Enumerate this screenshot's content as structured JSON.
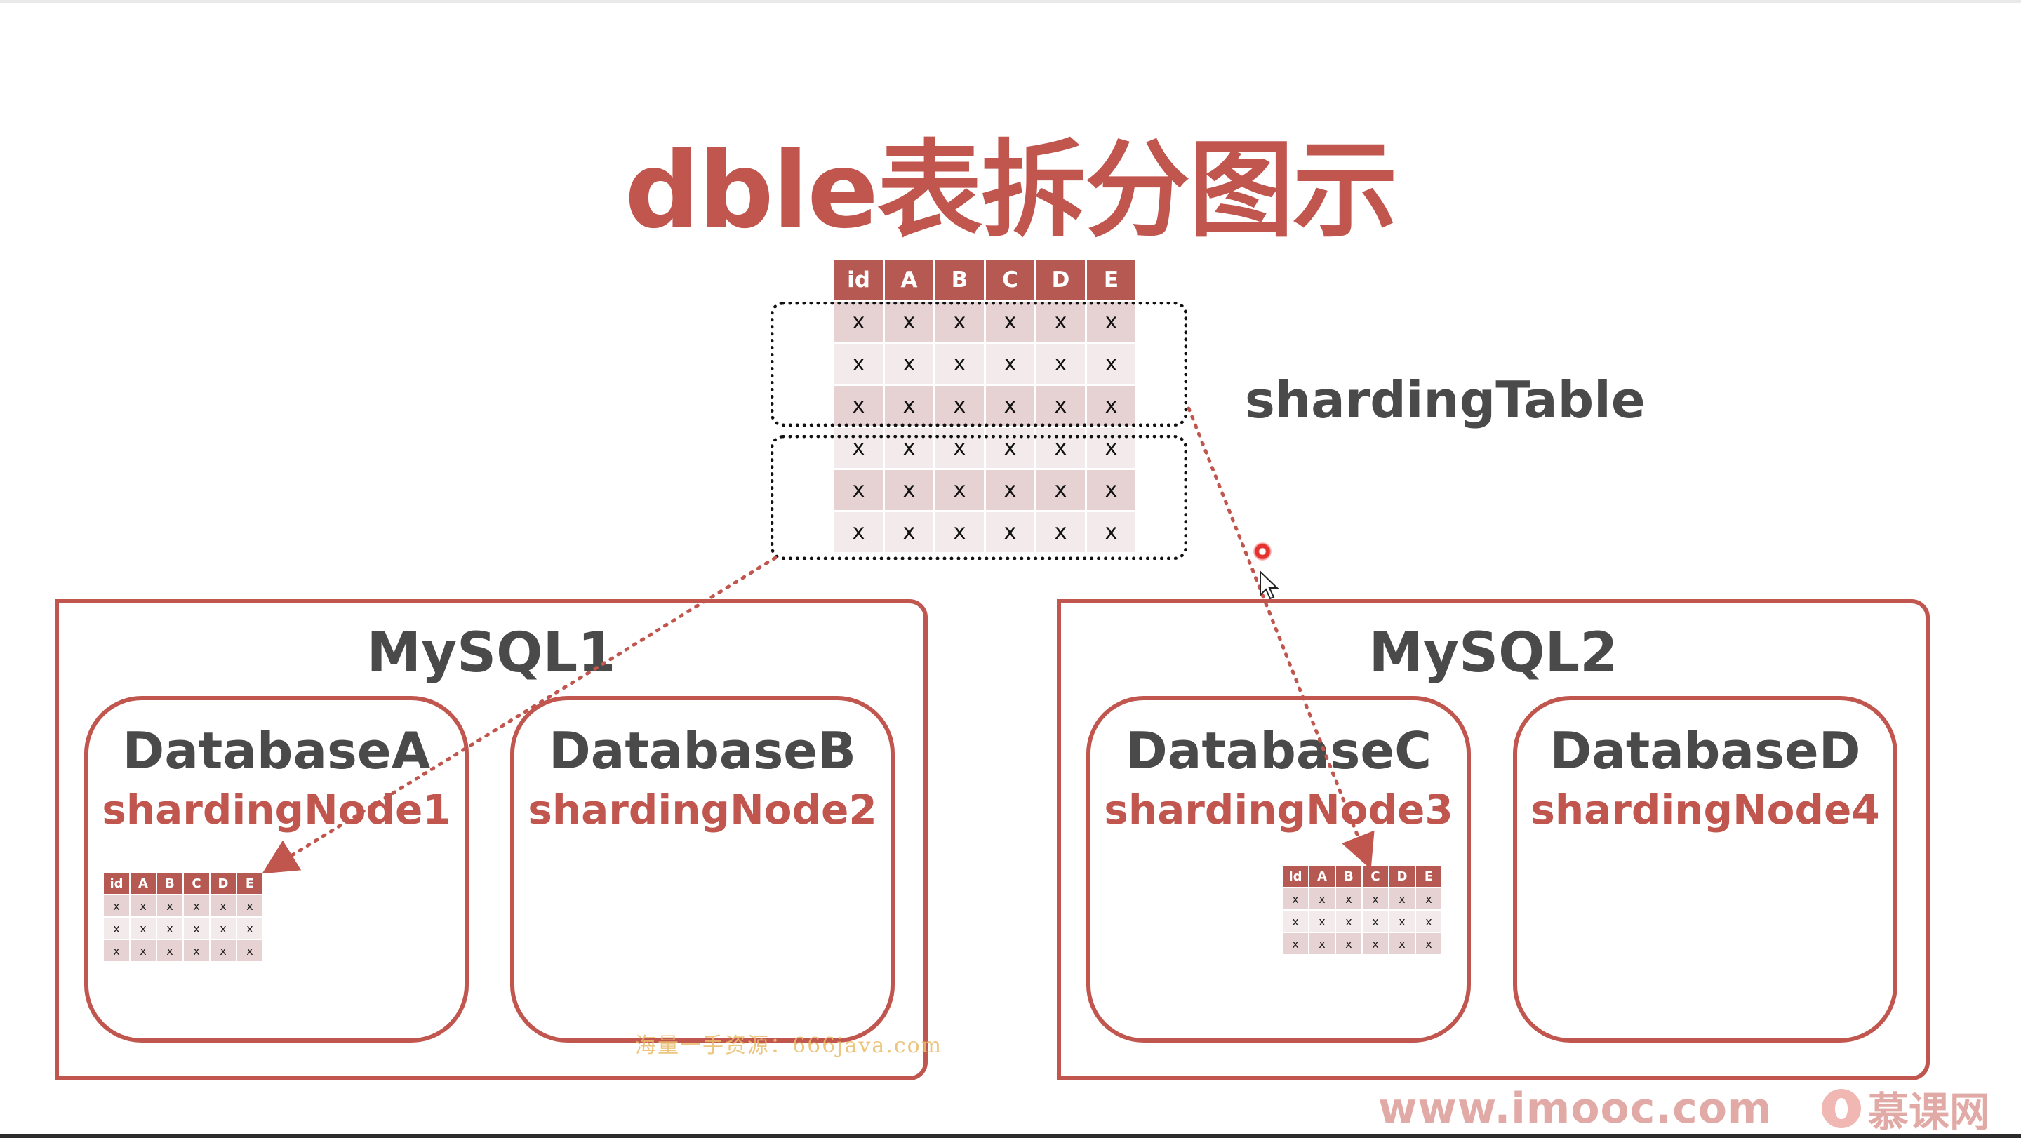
{
  "slide": {
    "title": "dble表拆分图示",
    "sharding_table_label": "shardingTable"
  },
  "big_table": {
    "headers": [
      "id",
      "A",
      "B",
      "C",
      "D",
      "E"
    ],
    "cell": "x",
    "row_count": 6
  },
  "servers": [
    {
      "title": "MySQL1",
      "databases": [
        {
          "name": "DatabaseA",
          "node": "shardingNode1"
        },
        {
          "name": "DatabaseB",
          "node": "shardingNode2"
        }
      ]
    },
    {
      "title": "MySQL2",
      "databases": [
        {
          "name": "DatabaseC",
          "node": "shardingNode3"
        },
        {
          "name": "DatabaseD",
          "node": "shardingNode4"
        }
      ]
    }
  ],
  "mini_table": {
    "headers": [
      "id",
      "A",
      "B",
      "C",
      "D",
      "E"
    ],
    "cell": "x",
    "row_count": 3
  },
  "watermark": "海量一手资源：666java.com",
  "footer": {
    "url": "www.imooc.com",
    "brand": "慕课网"
  },
  "colors": {
    "accent": "#c1564f",
    "header_fill": "#b75953",
    "row_dark": "#e6d2d2",
    "row_light": "#f3ebeb",
    "text_dark": "#4a4a4a"
  }
}
